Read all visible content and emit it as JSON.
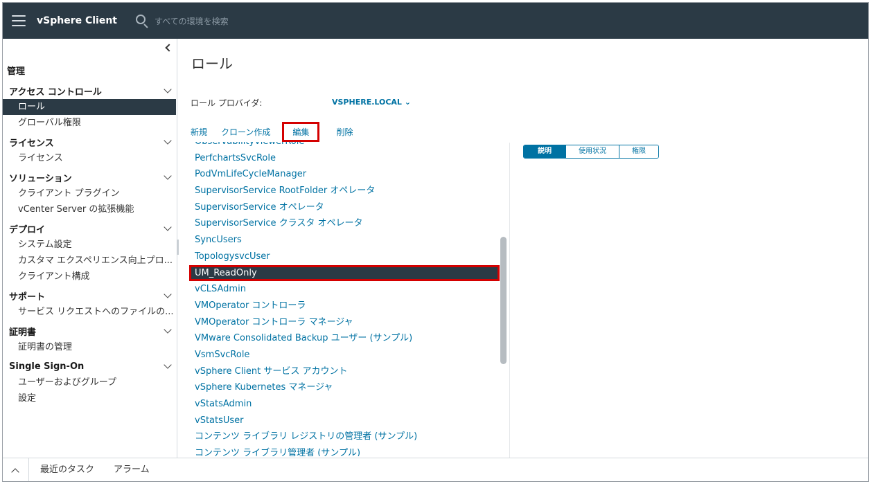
{
  "header": {
    "app_title": "vSphere Client",
    "search_placeholder": "すべての環境を検索"
  },
  "sidebar": {
    "title": "管理",
    "groups": [
      {
        "label": "アクセス コントロール",
        "items": [
          "ロール",
          "グローバル権限"
        ]
      },
      {
        "label": "ライセンス",
        "items": [
          "ライセンス"
        ]
      },
      {
        "label": "ソリューション",
        "items": [
          "クライアント プラグイン",
          "vCenter Server の拡張機能"
        ]
      },
      {
        "label": "デプロイ",
        "items": [
          "システム設定",
          "カスタマ エクスペリエンス向上プロ...",
          "クライアント構成"
        ]
      },
      {
        "label": "サポート",
        "items": [
          "サービス リクエストへのファイルの..."
        ]
      },
      {
        "label": "証明書",
        "items": [
          "証明書の管理"
        ]
      },
      {
        "label": "Single Sign-On",
        "items": [
          "ユーザーおよびグループ",
          "設定"
        ]
      }
    ],
    "active_item": "ロール"
  },
  "main": {
    "title": "ロール",
    "provider_label": "ロール プロバイダ:",
    "provider_value": "VSPHERE.LOCAL",
    "toolbar": {
      "new": "新規",
      "clone": "クローン作成",
      "edit": "編集",
      "delete": "削除"
    },
    "roles": [
      "ObservabilityViewerRole",
      "PerfchartsSvcRole",
      "PodVmLifeCycleManager",
      "SupervisorService RootFolder オペレータ",
      "SupervisorService オペレータ",
      "SupervisorService クラスタ オペレータ",
      "SyncUsers",
      "TopologysvcUser",
      "UM_ReadOnly",
      "vCLSAdmin",
      "VMOperator コントローラ",
      "VMOperator コントローラ マネージャ",
      "VMware Consolidated Backup ユーザー (サンプル)",
      "VsmSvcRole",
      "vSphere Client サービス アカウント",
      "vSphere Kubernetes マネージャ",
      "vStatsAdmin",
      "vStatsUser",
      "コンテンツ ライブラリ レジストリの管理者 (サンプル)",
      "コンテンツ ライブラリ管理者 (サンプル)"
    ],
    "selected_role": "UM_ReadOnly",
    "detail_tabs": [
      "説明",
      "使用状況",
      "権限"
    ],
    "active_detail_tab": "説明"
  },
  "bottom_bar": {
    "tabs": [
      "最近のタスク",
      "アラーム"
    ],
    "active_tab": "最近のタスク"
  },
  "colors": {
    "header_bg": "#2b3a45",
    "link": "#0072a3",
    "highlight": "#d40000"
  }
}
